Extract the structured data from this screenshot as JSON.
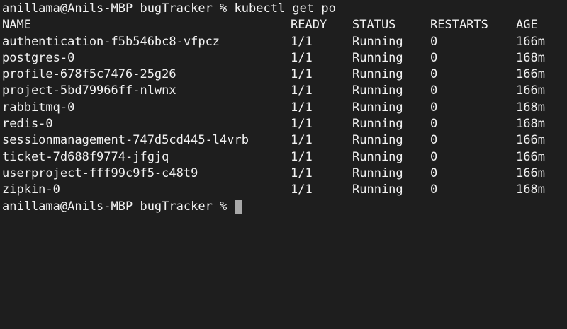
{
  "terminal": {
    "command_line": "anillama@Anils-MBP bugTracker % kubectl get po",
    "prompt": "anillama@Anils-MBP bugTracker % "
  },
  "table": {
    "headers": {
      "name": "NAME",
      "ready": "READY",
      "status": "STATUS",
      "restarts": "RESTARTS",
      "age": "AGE"
    },
    "rows": [
      {
        "name": "authentication-f5b546bc8-vfpcz",
        "ready": "1/1",
        "status": "Running",
        "restarts": "0",
        "age": "166m"
      },
      {
        "name": "postgres-0",
        "ready": "1/1",
        "status": "Running",
        "restarts": "0",
        "age": "168m"
      },
      {
        "name": "profile-678f5c7476-25g26",
        "ready": "1/1",
        "status": "Running",
        "restarts": "0",
        "age": "166m"
      },
      {
        "name": "project-5bd79966ff-nlwnx",
        "ready": "1/1",
        "status": "Running",
        "restarts": "0",
        "age": "166m"
      },
      {
        "name": "rabbitmq-0",
        "ready": "1/1",
        "status": "Running",
        "restarts": "0",
        "age": "168m"
      },
      {
        "name": "redis-0",
        "ready": "1/1",
        "status": "Running",
        "restarts": "0",
        "age": "168m"
      },
      {
        "name": "sessionmanagement-747d5cd445-l4vrb",
        "ready": "1/1",
        "status": "Running",
        "restarts": "0",
        "age": "166m"
      },
      {
        "name": "ticket-7d688f9774-jfgjq",
        "ready": "1/1",
        "status": "Running",
        "restarts": "0",
        "age": "166m"
      },
      {
        "name": "userproject-fff99c9f5-c48t9",
        "ready": "1/1",
        "status": "Running",
        "restarts": "0",
        "age": "166m"
      },
      {
        "name": "zipkin-0",
        "ready": "1/1",
        "status": "Running",
        "restarts": "0",
        "age": "168m"
      }
    ]
  },
  "colors": {
    "background": "#1e1e1e",
    "text": "#f2f2f2",
    "cursor": "#a9a9a9"
  }
}
